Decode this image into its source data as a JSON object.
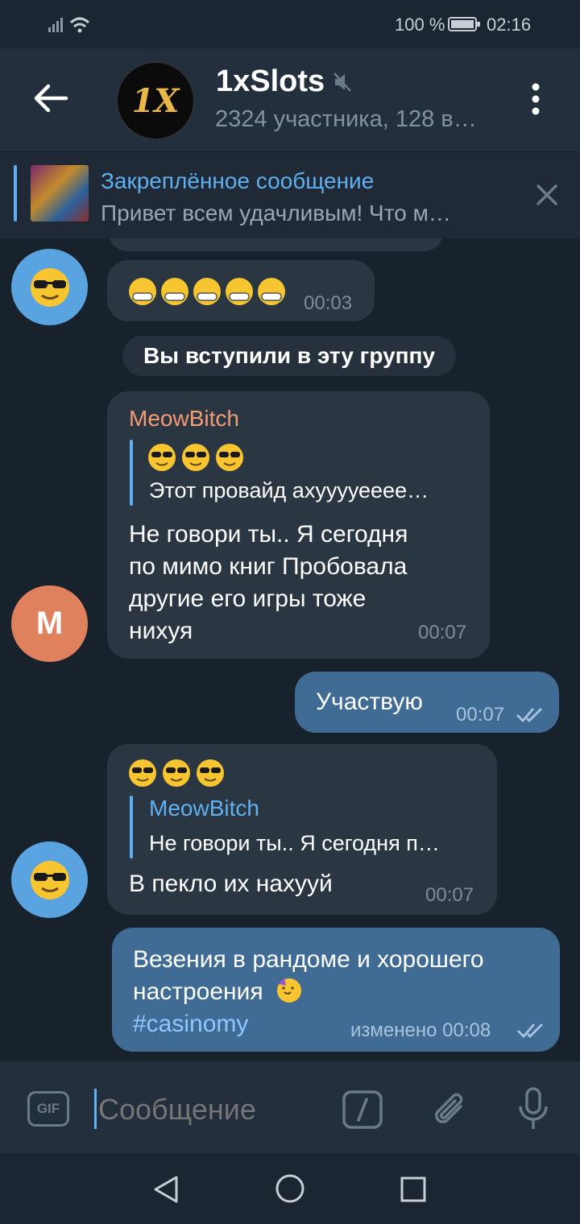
{
  "status_bar": {
    "battery_text": "100 %",
    "time": "02:16"
  },
  "header": {
    "title": "1xSlots",
    "subtitle": "2324 участника, 128 в…",
    "avatar_text": "1X"
  },
  "pinned": {
    "title": "Закреплённое сообщение",
    "preview": "Привет всем удачливым! Что м…"
  },
  "messages": {
    "m1_time": "00:03",
    "service": "Вы вступили в эту группу",
    "m2": {
      "author": "MeowBitch",
      "reply_text": "Этот провайд ахууууееее…",
      "text_lines": [
        "Не говори ты.. Я сегодня",
        "по мимо книг Пробовала",
        "другие его игры тоже",
        "нихуя"
      ],
      "time": "00:07",
      "avatar_letter": "M"
    },
    "m3": {
      "text": "Участвую",
      "time": "00:07"
    },
    "m4": {
      "reply_author": "MeowBitch",
      "reply_text": "Не говори ты.. Я сегодня п…",
      "text": "В пекло их нахууй",
      "time": "00:07"
    },
    "m5": {
      "line1": "Везения в рандоме и хорошего",
      "line2": "настроения",
      "hashtag": "#casinomy",
      "meta": "изменено 00:08"
    }
  },
  "input": {
    "placeholder": "Сообщение",
    "gif_label": "GIF"
  },
  "colors": {
    "accent": "#5fb0f0",
    "author": "#f29b74",
    "outgoing": "#3f6b94"
  },
  "icons": [
    "back-arrow-icon",
    "mute-icon",
    "more-icon",
    "close-icon",
    "gif-icon",
    "command-icon",
    "attach-icon",
    "mic-icon",
    "nav-back-icon",
    "nav-home-icon",
    "nav-recent-icon"
  ]
}
